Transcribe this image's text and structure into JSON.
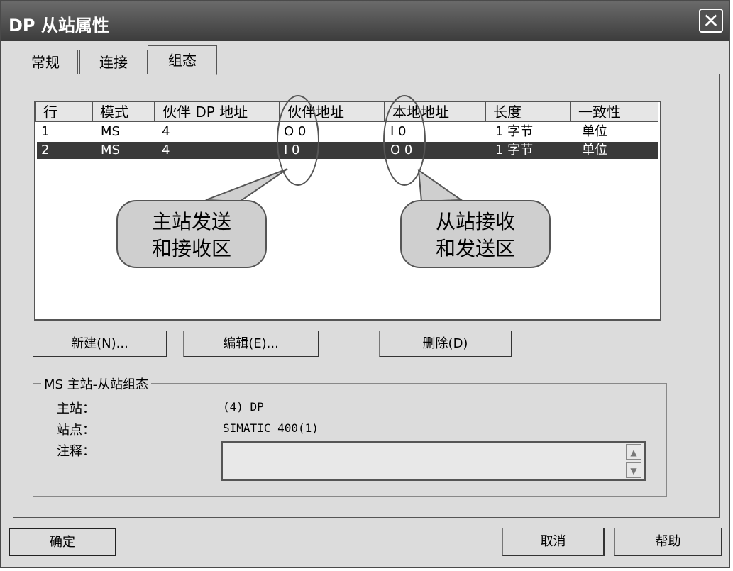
{
  "window": {
    "title": "DP 从站属性",
    "close_glyph": "✕"
  },
  "tabs": [
    {
      "label": "常规"
    },
    {
      "label": "连接"
    },
    {
      "label": "组态"
    }
  ],
  "table": {
    "columns": [
      "行",
      "模式",
      "伙伴 DP 地址",
      "伙伴地址",
      "本地地址",
      "长度",
      "一致性"
    ],
    "rows": [
      {
        "row": "1",
        "mode": "MS",
        "partner_dp": "4",
        "partner_addr": "O 0",
        "local_addr": "I 0",
        "length": "1 字节",
        "consistency": "单位"
      },
      {
        "row": "2",
        "mode": "MS",
        "partner_dp": "4",
        "partner_addr": "I 0",
        "local_addr": "O 0",
        "length": "1 字节",
        "consistency": "单位"
      }
    ]
  },
  "callouts": [
    {
      "line1": "主站发送",
      "line2": "和接收区"
    },
    {
      "line1": "从站接收",
      "line2": "和发送区"
    }
  ],
  "buttons": {
    "new": "新建(N)...",
    "edit": "编辑(E)...",
    "delete": "删除(D)"
  },
  "group": {
    "title": "MS 主站-从站组态",
    "master_label": "主站：",
    "master_value": "(4) DP",
    "station_label": "站点：",
    "station_value": "SIMATIC 400(1)",
    "comment_label": "注释："
  },
  "footer": {
    "ok": "确定",
    "cancel": "取消",
    "help": "帮助"
  }
}
